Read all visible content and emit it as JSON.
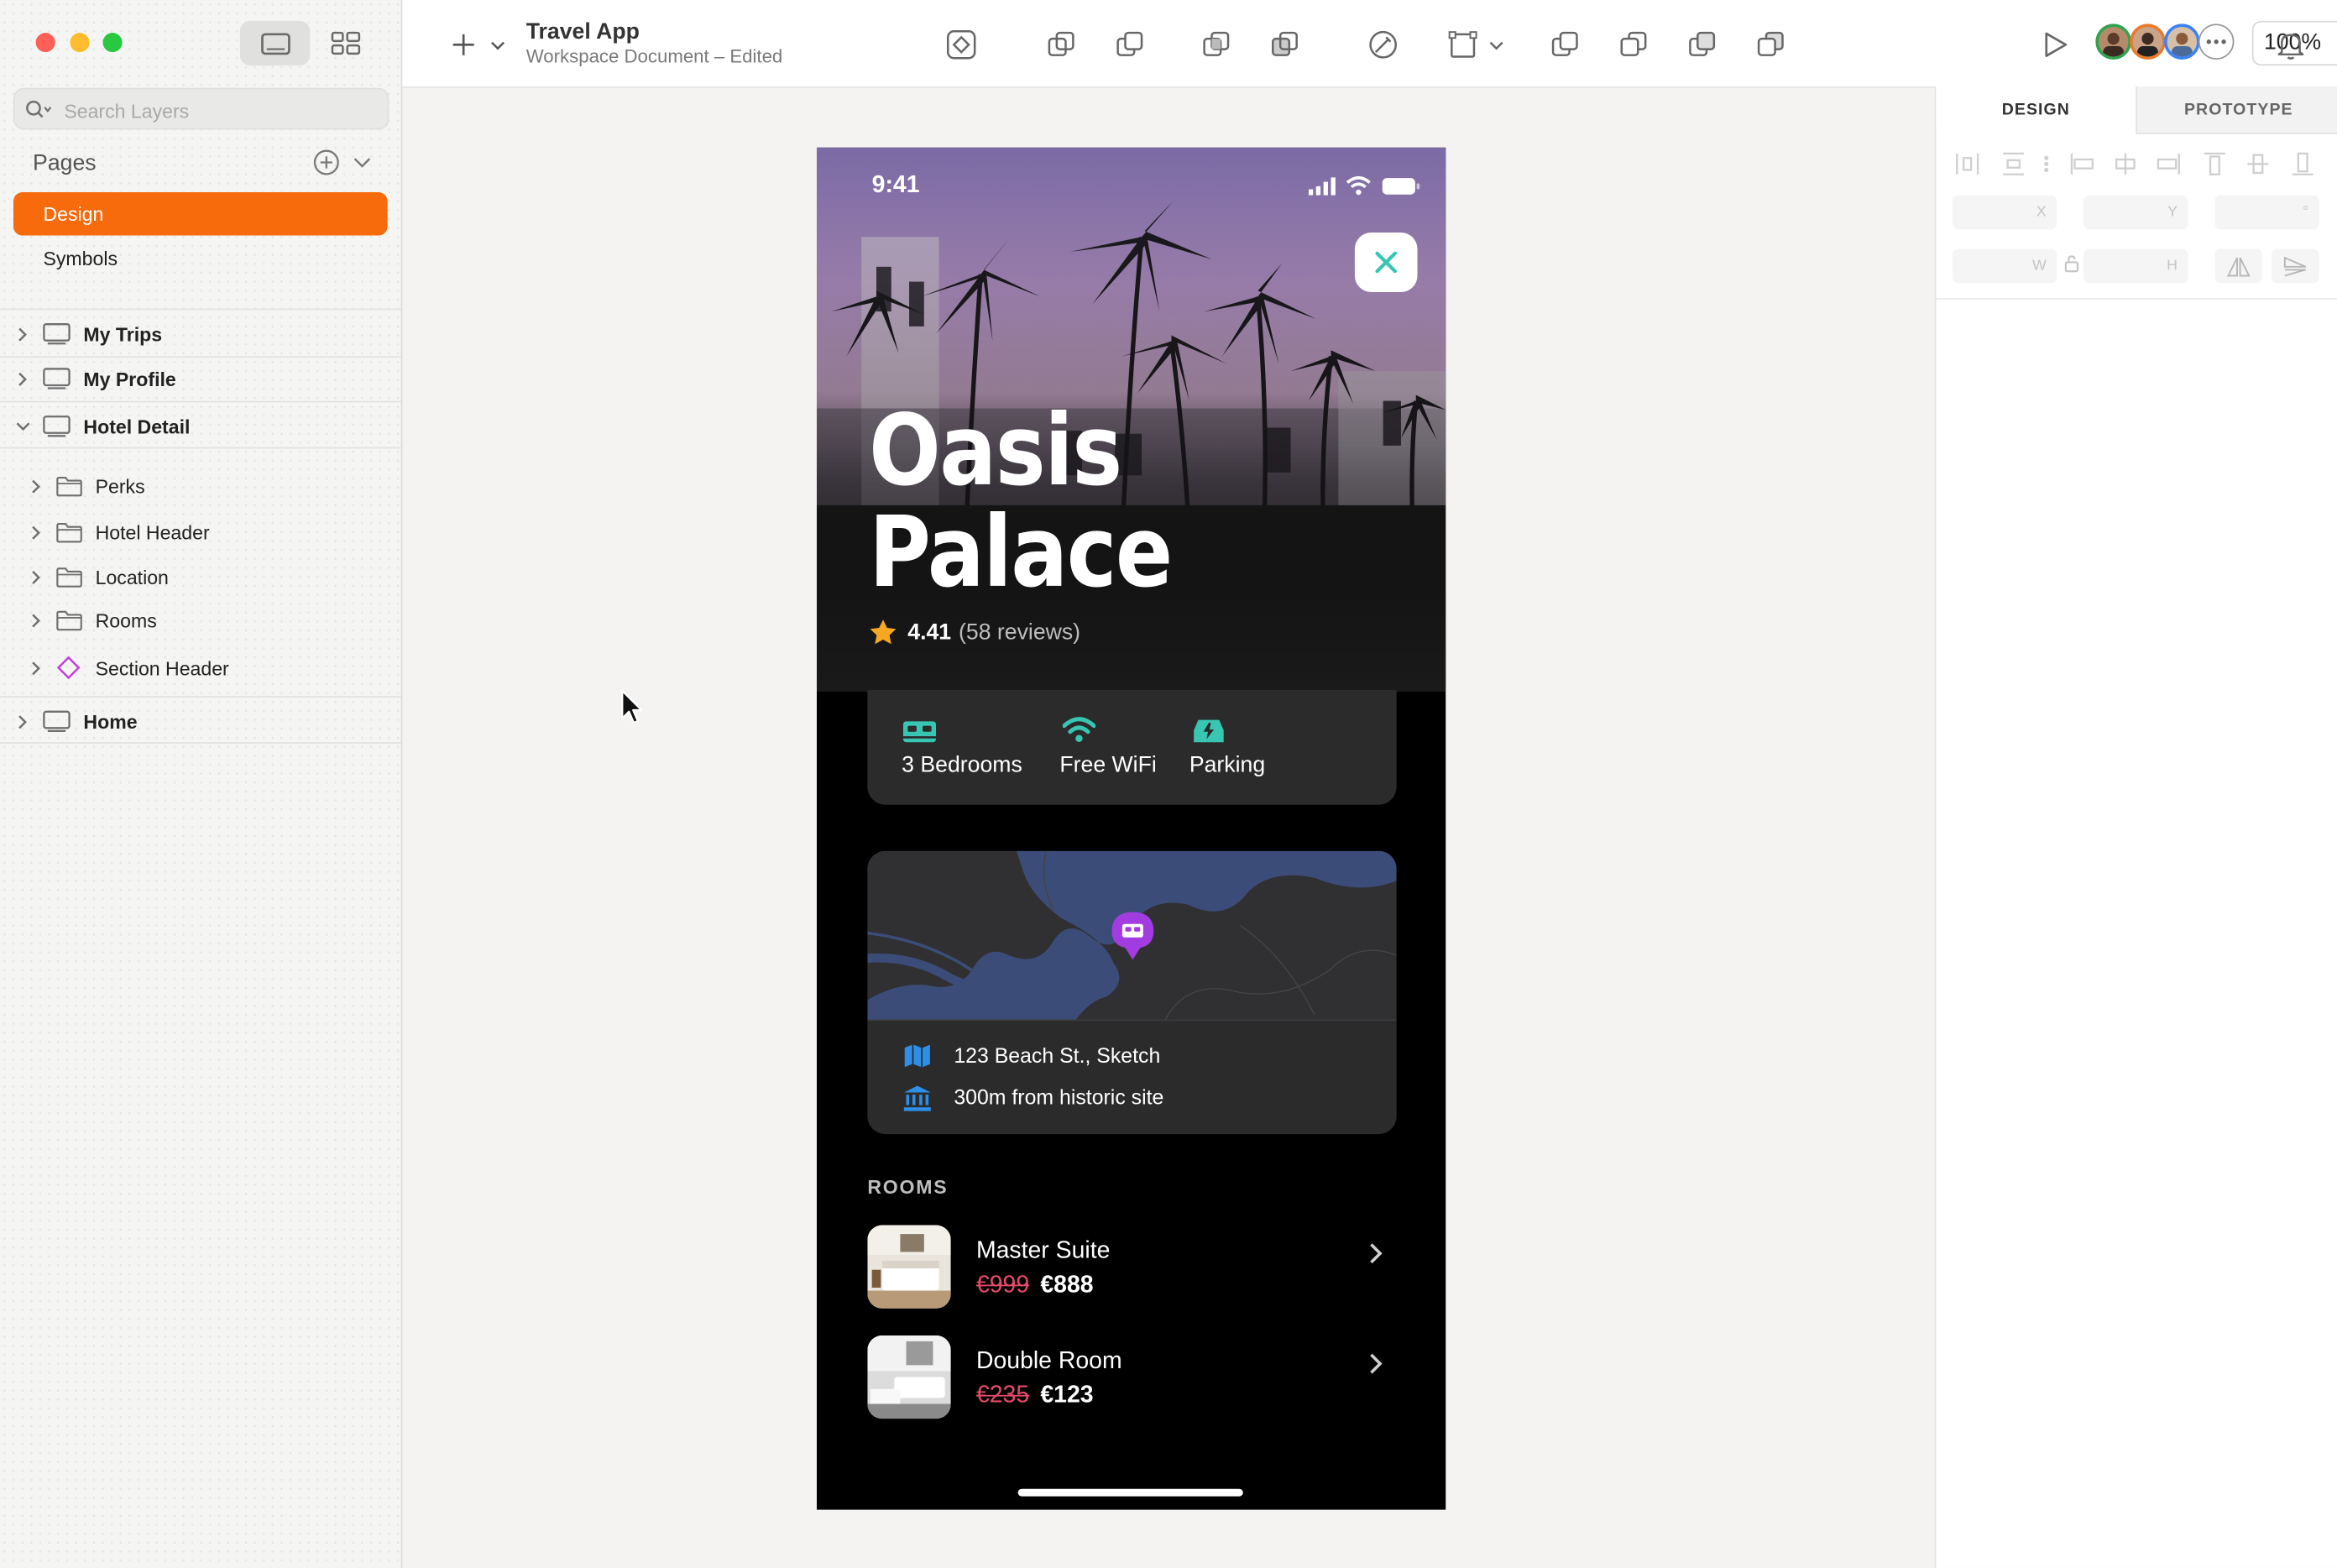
{
  "window": {
    "document_title": "Travel App",
    "document_subtitle": "Workspace Document – Edited",
    "zoom": "100%"
  },
  "sidebar": {
    "search_placeholder": "Search Layers",
    "pages_label": "Pages",
    "pages": [
      {
        "label": "Design",
        "selected": true
      },
      {
        "label": "Symbols",
        "selected": false
      }
    ],
    "artboards": [
      {
        "label": "My Trips",
        "expanded": false
      },
      {
        "label": "My Profile",
        "expanded": false
      },
      {
        "label": "Hotel Detail",
        "expanded": true
      }
    ],
    "hotel_detail_layers": [
      {
        "label": "Perks",
        "type": "group"
      },
      {
        "label": "Hotel Header",
        "type": "group"
      },
      {
        "label": "Location",
        "type": "group"
      },
      {
        "label": "Rooms",
        "type": "group"
      },
      {
        "label": "Section Header",
        "type": "symbol"
      }
    ],
    "home_artboard": {
      "label": "Home",
      "expanded": false
    }
  },
  "inspector": {
    "tabs": [
      {
        "label": "DESIGN",
        "active": true
      },
      {
        "label": "PROTOTYPE",
        "active": false
      }
    ],
    "fields": {
      "x": "X",
      "y": "Y",
      "rotation": "°",
      "w": "W",
      "h": "H"
    }
  },
  "phone": {
    "status_time": "9:41",
    "hotel_name_line1": "Oasis",
    "hotel_name_line2": "Palace",
    "rating": "4.41",
    "reviews": "(58 reviews)",
    "perks": [
      {
        "label": "3 Bedrooms",
        "icon": "bed-icon"
      },
      {
        "label": "Free WiFi",
        "icon": "wifi-icon"
      },
      {
        "label": "Parking",
        "icon": "car-icon"
      }
    ],
    "location": {
      "address": "123 Beach St., Sketch",
      "landmark": "300m from historic site"
    },
    "rooms_header": "ROOMS",
    "rooms": [
      {
        "name": "Master Suite",
        "old_price": "€999",
        "price": "€888"
      },
      {
        "name": "Double Room",
        "old_price": "€235",
        "price": "€123"
      }
    ]
  },
  "colors": {
    "accent_orange": "#f76b0c",
    "teal": "#38c6b3",
    "strike_red": "#e64a6a",
    "pin_purple": "#a23be0",
    "map_water": "#3c4c78",
    "card_dark": "#2b2b2b"
  }
}
